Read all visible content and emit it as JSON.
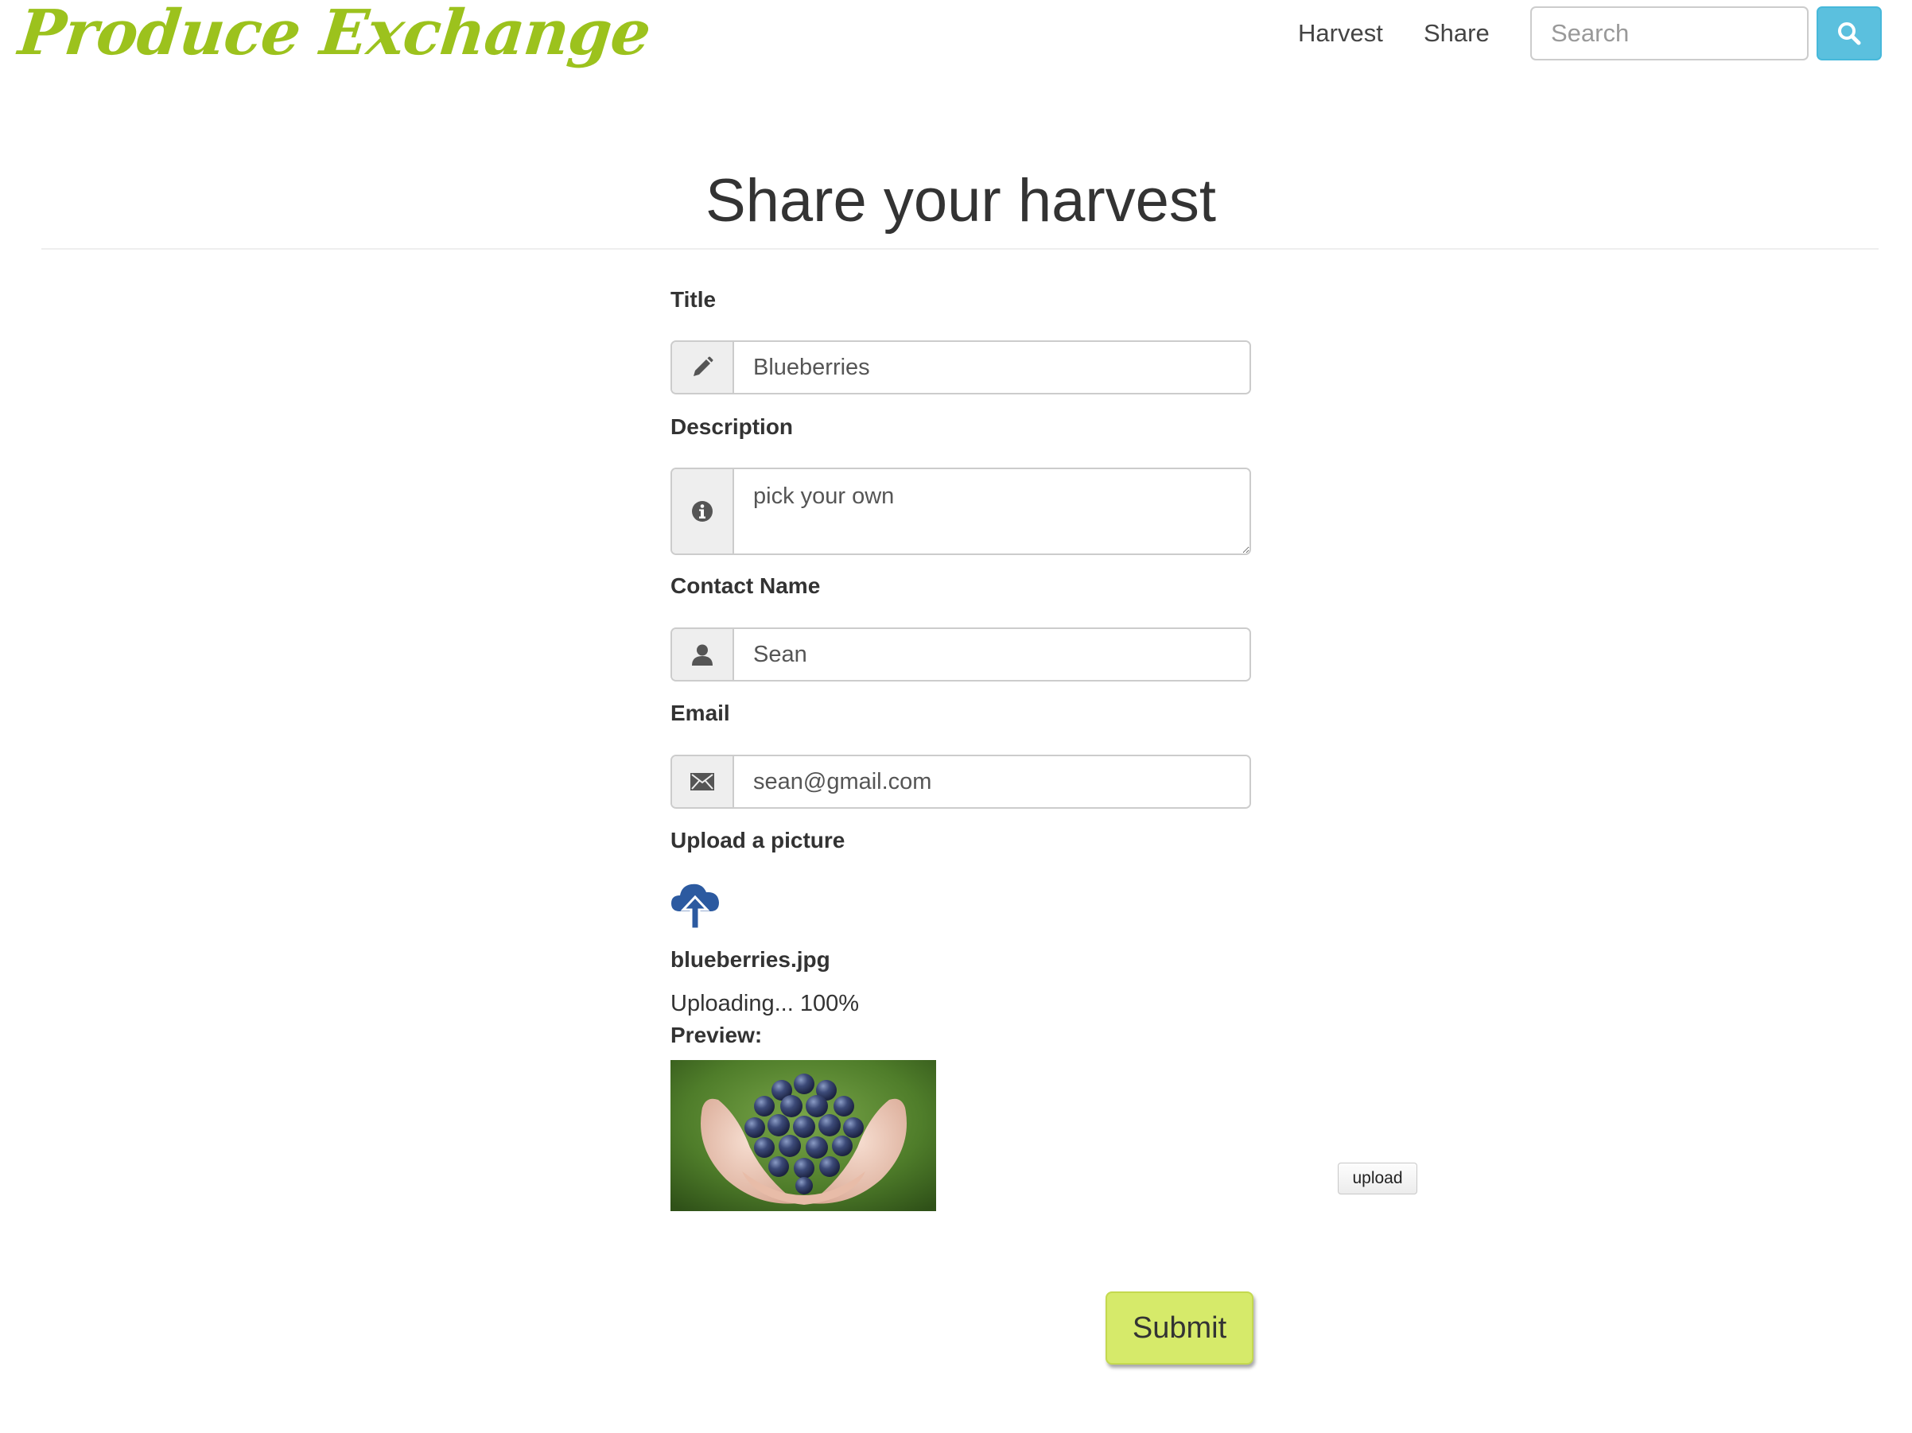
{
  "navbar": {
    "brand": "Produce Exchange",
    "links": [
      {
        "label": "Harvest"
      },
      {
        "label": "Share"
      }
    ],
    "search": {
      "placeholder": "Search",
      "value": ""
    }
  },
  "page": {
    "title": "Share your harvest"
  },
  "form": {
    "title": {
      "label": "Title",
      "value": "Blueberries",
      "icon": "pencil-icon"
    },
    "description": {
      "label": "Description",
      "value": "pick your own",
      "icon": "info-icon"
    },
    "contact_name": {
      "label": "Contact Name",
      "value": "Sean",
      "icon": "user-icon"
    },
    "email": {
      "label": "Email",
      "value": "sean@gmail.com",
      "icon": "envelope-icon"
    },
    "upload": {
      "label": "Upload a picture",
      "icon": "cloud-upload-icon",
      "file_name": "blueberries.jpg",
      "status": "Uploading... 100%",
      "progress_percent": 100,
      "preview_label": "Preview:",
      "preview_image": "blueberries-in-hands",
      "upload_button": "upload"
    },
    "submit_label": "Submit"
  },
  "colors": {
    "brand": "#9cc21d",
    "search_button": "#5bc0de",
    "submit_button": "#d6ea6a",
    "upload_icon": "#2c5aa0"
  }
}
